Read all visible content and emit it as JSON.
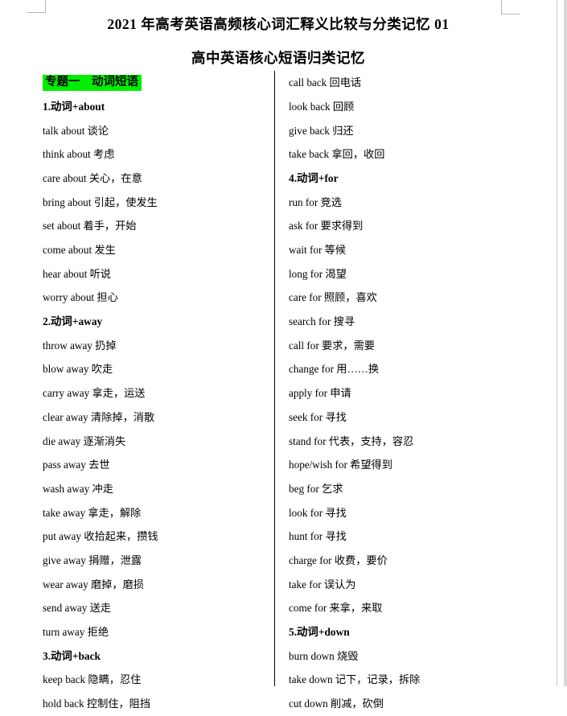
{
  "document": {
    "title_main": "2021 年高考英语高频核心词汇释义比较与分类记忆 01",
    "title_sub": "高中英语核心短语归类记忆",
    "highlight_color": "#00ee00",
    "text_color": "#000000",
    "page_background": "#ffffff"
  },
  "left_column": {
    "entries": [
      {
        "type": "section",
        "text": "专题一　动词短语"
      },
      {
        "type": "sub",
        "text": "1.动词+about"
      },
      {
        "type": "item",
        "text": "talk about 谈论"
      },
      {
        "type": "item",
        "text": "think about 考虑"
      },
      {
        "type": "item",
        "text": "care about 关心，在意"
      },
      {
        "type": "item",
        "text": "bring about 引起，使发生"
      },
      {
        "type": "item",
        "text": "set about 着手，开始"
      },
      {
        "type": "item",
        "text": "come about 发生"
      },
      {
        "type": "item",
        "text": "hear about 听说"
      },
      {
        "type": "item",
        "text": "worry about 担心"
      },
      {
        "type": "sub",
        "text": "2.动词+away"
      },
      {
        "type": "item",
        "text": "throw away 扔掉"
      },
      {
        "type": "item",
        "text": "blow away 吹走"
      },
      {
        "type": "item",
        "text": "carry away 拿走，运送"
      },
      {
        "type": "item",
        "text": "clear away 清除掉，消散"
      },
      {
        "type": "item",
        "text": "die away 逐渐消失"
      },
      {
        "type": "item",
        "text": "pass away 去世"
      },
      {
        "type": "item",
        "text": "wash away 冲走"
      },
      {
        "type": "item",
        "text": "take away 拿走，解除"
      },
      {
        "type": "item",
        "text": "put away 收拾起来，攒钱"
      },
      {
        "type": "item",
        "text": "give away 捐赠，泄露"
      },
      {
        "type": "item",
        "text": "wear away 磨掉，磨损"
      },
      {
        "type": "item",
        "text": "send away 送走"
      },
      {
        "type": "item",
        "text": "turn away 拒绝"
      },
      {
        "type": "sub",
        "text": "3.动词+back"
      },
      {
        "type": "item",
        "text": "keep back 隐瞒，忍住"
      },
      {
        "type": "item",
        "text": "hold back 控制住，阻挡"
      }
    ]
  },
  "right_column": {
    "entries": [
      {
        "type": "item",
        "text": "call back 回电话"
      },
      {
        "type": "item",
        "text": "look back 回顾"
      },
      {
        "type": "item",
        "text": "give back 归还"
      },
      {
        "type": "item",
        "text": "take back 拿回，收回"
      },
      {
        "type": "sub",
        "text": "4.动词+for"
      },
      {
        "type": "item",
        "text": "run for 竞选"
      },
      {
        "type": "item",
        "text": "ask for 要求得到"
      },
      {
        "type": "item",
        "text": "wait for 等候"
      },
      {
        "type": "item",
        "text": "long for 渴望"
      },
      {
        "type": "item",
        "text": "care for 照顾，喜欢"
      },
      {
        "type": "item",
        "text": "search for 搜寻"
      },
      {
        "type": "item",
        "text": "call for 要求，需要"
      },
      {
        "type": "item",
        "text": "change for 用……换"
      },
      {
        "type": "item",
        "text": "apply for 申请"
      },
      {
        "type": "item",
        "text": "seek for 寻找"
      },
      {
        "type": "item",
        "text": "stand for 代表，支持，容忍"
      },
      {
        "type": "item",
        "text": "hope/wish for 希望得到"
      },
      {
        "type": "item",
        "text": "beg for 乞求"
      },
      {
        "type": "item",
        "text": "look for 寻找"
      },
      {
        "type": "item",
        "text": "hunt for 寻找"
      },
      {
        "type": "item",
        "text": "charge for 收费，要价"
      },
      {
        "type": "item",
        "text": "take for 误认为"
      },
      {
        "type": "item",
        "text": "come for 来拿，来取"
      },
      {
        "type": "sub",
        "text": "5.动词+down"
      },
      {
        "type": "item",
        "text": "burn down 烧毁"
      },
      {
        "type": "item",
        "text": "take down 记下，记录，拆除"
      },
      {
        "type": "item",
        "text": "cut down 削减，砍倒"
      }
    ]
  }
}
